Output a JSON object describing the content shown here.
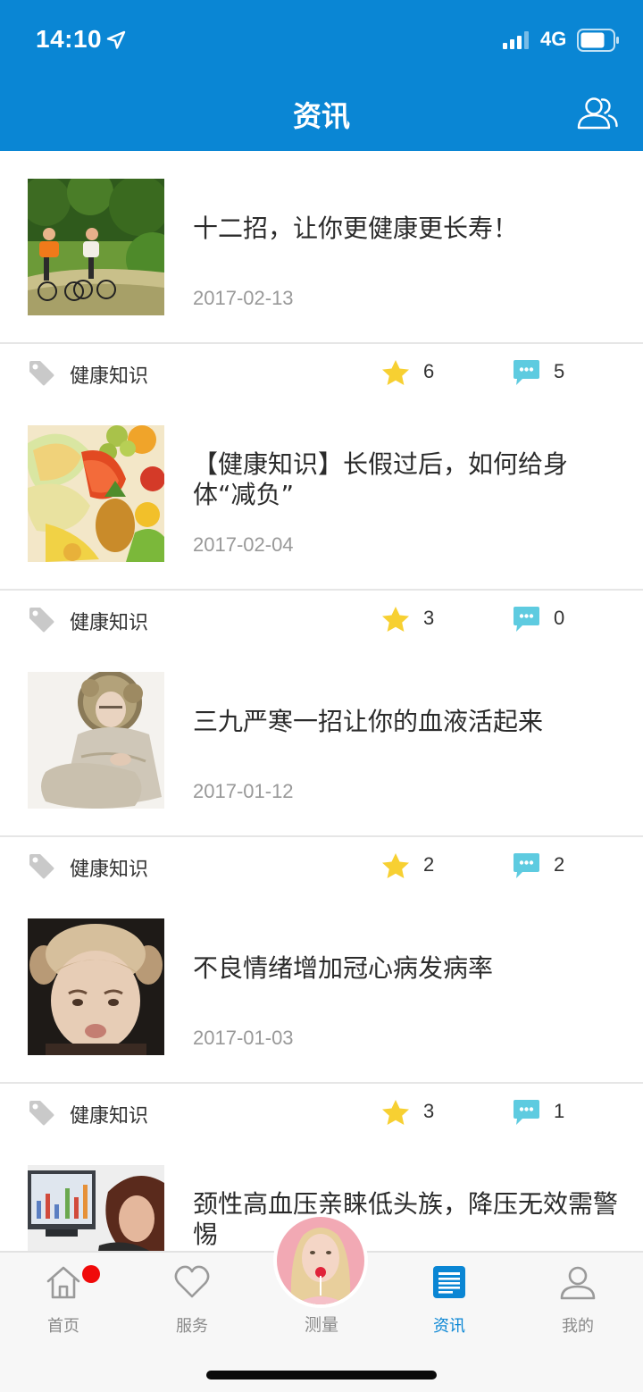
{
  "status_bar": {
    "time": "14:10",
    "network": "4G"
  },
  "header": {
    "title": "资讯"
  },
  "articles": [
    {
      "title": "十二招，让你更健康更长寿！",
      "date": "2017-02-13",
      "tag": "健康知识",
      "stars": "6",
      "comments": "5",
      "image": "cyclists-photo"
    },
    {
      "title": "【健康知识】长假过后，如何给身体“减负”",
      "date": "2017-02-04",
      "tag": "健康知识",
      "stars": "3",
      "comments": "0",
      "image": "fruits-photo"
    },
    {
      "title": "三九严寒一招让你的血液活起来",
      "date": "2017-01-12",
      "tag": "健康知识",
      "stars": "2",
      "comments": "2",
      "image": "cold-woman-photo"
    },
    {
      "title": "不良情绪增加冠心病发病率",
      "date": "2017-01-03",
      "tag": "健康知识",
      "stars": "3",
      "comments": "1",
      "image": "sad-child-photo"
    },
    {
      "title": "颈性高血压亲睐低头族，降压无效需警惕",
      "image": "office-woman-photo"
    }
  ],
  "tabbar": {
    "home": "首页",
    "service": "服务",
    "measure": "测量",
    "news": "资讯",
    "mine": "我的"
  },
  "colors": {
    "brand": "#0a86d4",
    "star": "#f7d032",
    "comment": "#5ecbe0",
    "badge": "#f00a0a"
  }
}
